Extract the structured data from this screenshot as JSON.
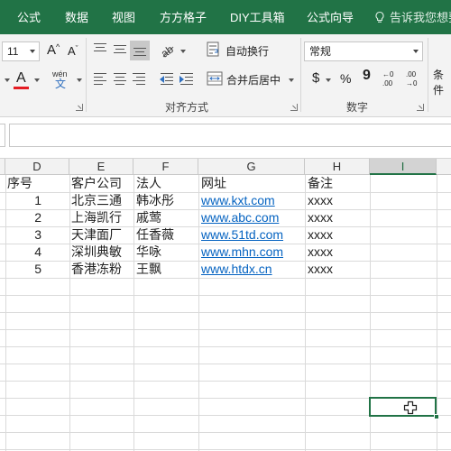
{
  "tabs": [
    {
      "label": "公式"
    },
    {
      "label": "数据"
    },
    {
      "label": "视图"
    },
    {
      "label": "方方格子"
    },
    {
      "label": "DIY工具箱"
    },
    {
      "label": "公式向导"
    }
  ],
  "tell_me": "告诉我您想要",
  "ribbon": {
    "font_size": "11",
    "grow_font": "A",
    "shrink_font": "A",
    "font_color_glyph": "A",
    "phonetic_top": "wén",
    "phonetic_bottom": "文",
    "wrap_text": "自动换行",
    "merge_center": "合并后居中",
    "alignment_group": "对齐方式",
    "number_format": "常规",
    "currency": "$",
    "percent": "%",
    "comma": "9",
    "number_group": "数字",
    "conditional": "条件",
    "inc_decimal_top": "←0",
    "inc_decimal_bottom": ".00",
    "dec_decimal_top": ".00",
    "dec_decimal_bottom": "→0"
  },
  "columns": [
    "D",
    "E",
    "F",
    "G",
    "H",
    "I"
  ],
  "active_column": "I",
  "table": {
    "headers": [
      "序号",
      "客户公司",
      "法人",
      "网址",
      "备注"
    ],
    "rows": [
      [
        "1",
        "北京三通",
        "韩冰彤",
        "www.kxt.com",
        "xxxx"
      ],
      [
        "2",
        "上海凯行",
        "戚莺",
        "www.abc.com",
        "xxxx"
      ],
      [
        "3",
        "天津面厂",
        "任香薇",
        "www.51td.com",
        "xxxx"
      ],
      [
        "4",
        "深圳典敏",
        "华咏",
        "www.mhn.com",
        "xxxx"
      ],
      [
        "5",
        "香港冻粉",
        "王飘",
        "www.htdx.cn",
        "xxxx"
      ]
    ]
  },
  "colors": {
    "excel_green": "#217346",
    "link_blue": "#0563c1",
    "font_color_bar": "#e51c23"
  }
}
